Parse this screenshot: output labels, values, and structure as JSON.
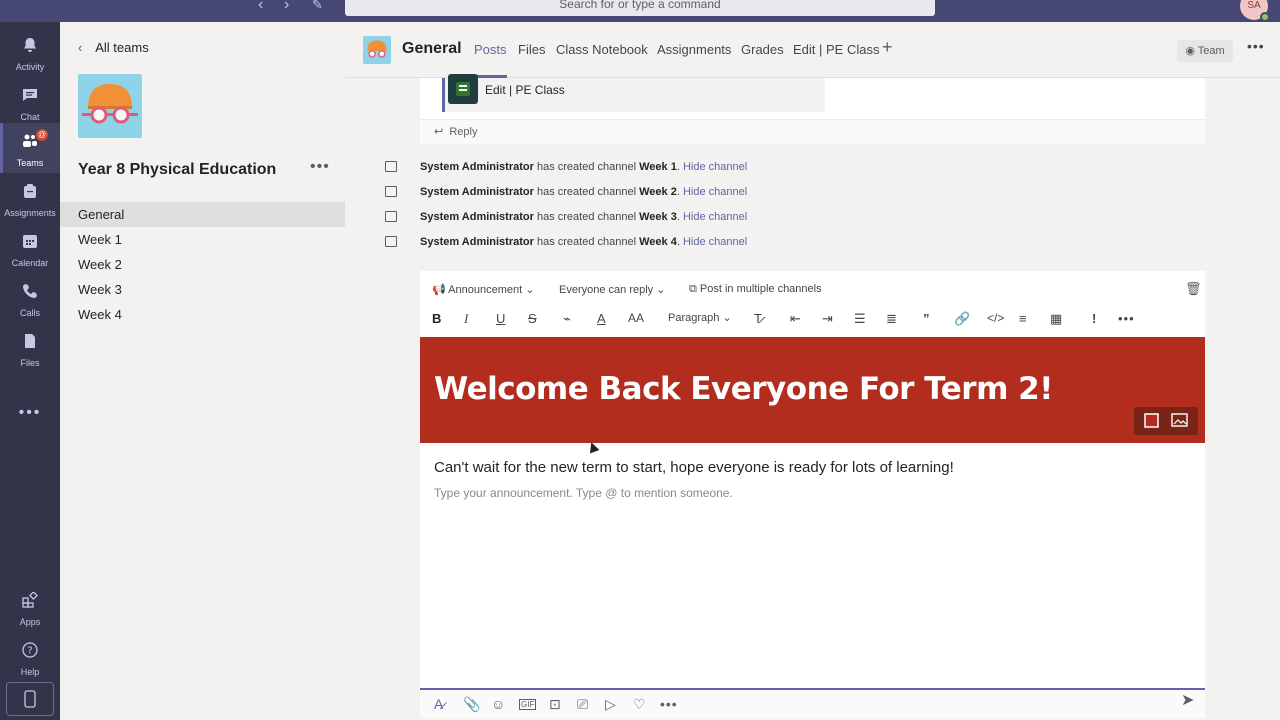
{
  "topbar": {
    "search_placeholder": "Search for or type a command",
    "avatar_initials": "SA"
  },
  "rail": {
    "items": [
      {
        "label": "Activity",
        "icon": "bell-icon"
      },
      {
        "label": "Chat",
        "icon": "chat-icon"
      },
      {
        "label": "Teams",
        "icon": "teams-icon",
        "active": true,
        "badge": "@"
      },
      {
        "label": "Assignments",
        "icon": "assignments-icon"
      },
      {
        "label": "Calendar",
        "icon": "calendar-icon"
      },
      {
        "label": "Calls",
        "icon": "phone-icon"
      },
      {
        "label": "Files",
        "icon": "file-icon"
      }
    ],
    "more": "•••",
    "apps_label": "Apps",
    "help_label": "Help"
  },
  "teampanel": {
    "back_label": "All teams",
    "team_name": "Year 8 Physical Education",
    "more": "•••",
    "channels": [
      "General",
      "Week 1",
      "Week 2",
      "Week 3",
      "Week 4"
    ],
    "active_channel": "General"
  },
  "header": {
    "channel_title": "General",
    "tabs": [
      "Posts",
      "Files",
      "Class Notebook",
      "Assignments",
      "Grades",
      "Edit | PE Class"
    ],
    "active_tab": "Posts",
    "team_button": "Team",
    "more": "•••"
  },
  "feed": {
    "app_card_title": "Edit | PE Class",
    "reply_label": "Reply",
    "system_messages": [
      {
        "actor": "System Administrator",
        "text": "has created channel",
        "channel": "Week 1",
        "link": "Hide channel"
      },
      {
        "actor": "System Administrator",
        "text": "has created channel",
        "channel": "Week 2",
        "link": "Hide channel"
      },
      {
        "actor": "System Administrator",
        "text": "has created channel",
        "channel": "Week 3",
        "link": "Hide channel"
      },
      {
        "actor": "System Administrator",
        "text": "has created channel",
        "channel": "Week 4",
        "link": "Hide channel"
      }
    ]
  },
  "composer": {
    "post_type": "Announcement",
    "reply_setting": "Everyone can reply",
    "multi_channel": "Post in multiple channels",
    "paragraph_style": "Paragraph",
    "headline": "Welcome Back Everyone For Term 2!",
    "subhead": "Can't wait for the new term to start, hope everyone is ready for lots of learning!",
    "placeholder": "Type your announcement. Type @ to mention someone.",
    "colors": {
      "banner": "#b32d1f",
      "accent": "#6264a7"
    }
  }
}
